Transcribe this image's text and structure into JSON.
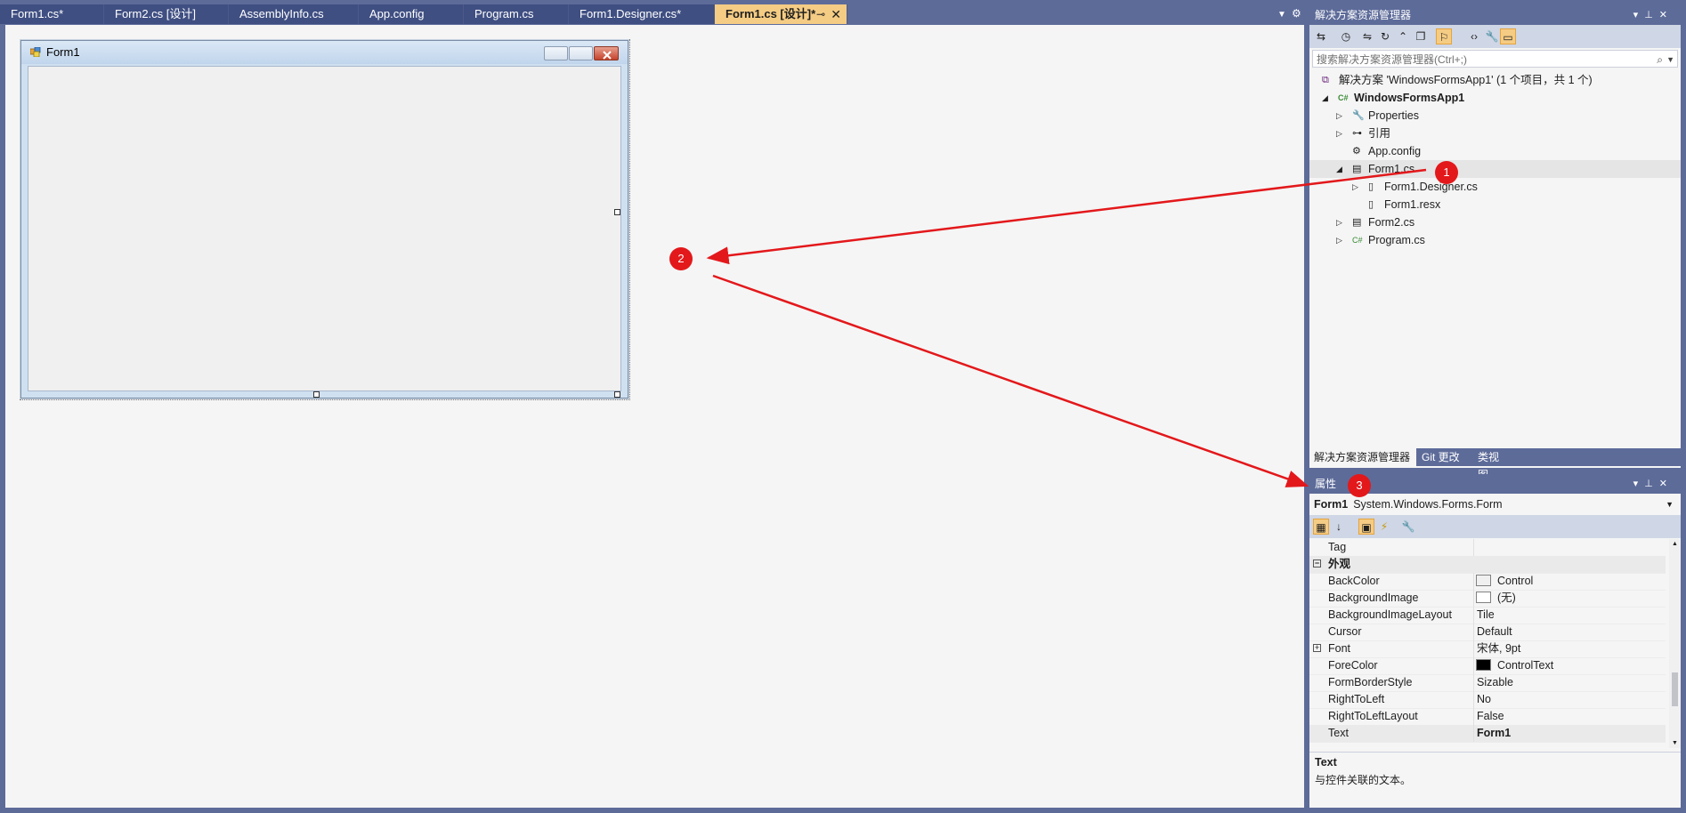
{
  "tabs": [
    {
      "label": "Form1.cs*"
    },
    {
      "label": "Form2.cs [设计]"
    },
    {
      "label": "AssemblyInfo.cs"
    },
    {
      "label": "App.config"
    },
    {
      "label": "Program.cs"
    },
    {
      "label": "Form1.Designer.cs*"
    },
    {
      "label": "Form1.cs [设计]*",
      "active": true
    }
  ],
  "designer": {
    "form_title": "Form1"
  },
  "solution_explorer": {
    "title": "解决方案资源管理器",
    "search_placeholder": "搜索解决方案资源管理器(Ctrl+;)",
    "tree": [
      {
        "label": "解决方案 'WindowsFormsApp1' (1 个项目，共 1 个)",
        "icon": "solution-icon"
      },
      {
        "label": "WindowsFormsApp1",
        "icon": "csharp-project-icon",
        "bold": true
      },
      {
        "label": "Properties",
        "icon": "wrench-icon"
      },
      {
        "label": "引用",
        "icon": "references-icon"
      },
      {
        "label": "App.config",
        "icon": "config-file-icon"
      },
      {
        "label": "Form1.cs",
        "icon": "form-icon",
        "selected": true
      },
      {
        "label": "Form1.Designer.cs",
        "icon": "cs-file-icon"
      },
      {
        "label": "Form1.resx",
        "icon": "resx-file-icon"
      },
      {
        "label": "Form2.cs",
        "icon": "form-icon"
      },
      {
        "label": "Program.cs",
        "icon": "csharp-file-icon"
      }
    ],
    "bottom_tabs": [
      "解决方案资源管理器",
      "Git 更改",
      "类视图"
    ]
  },
  "properties": {
    "title": "属性",
    "object_name": "Form1",
    "object_type": "System.Windows.Forms.Form",
    "rows": [
      {
        "name": "Tag",
        "value": ""
      },
      {
        "name": "外观",
        "category": true
      },
      {
        "name": "BackColor",
        "value": "Control",
        "swatch": "#f0f0f0"
      },
      {
        "name": "BackgroundImage",
        "value": "(无)",
        "swatch": "#ffffff"
      },
      {
        "name": "BackgroundImageLayout",
        "value": "Tile"
      },
      {
        "name": "Cursor",
        "value": "Default"
      },
      {
        "name": "Font",
        "value": "宋体, 9pt",
        "expandable": true
      },
      {
        "name": "ForeColor",
        "value": "ControlText",
        "swatch": "#000000"
      },
      {
        "name": "FormBorderStyle",
        "value": "Sizable"
      },
      {
        "name": "RightToLeft",
        "value": "No"
      },
      {
        "name": "RightToLeftLayout",
        "value": "False"
      },
      {
        "name": "Text",
        "value": "Form1",
        "bold_value": true,
        "selected": true
      }
    ],
    "description_title": "Text",
    "description_text": "与控件关联的文本。"
  },
  "annotations": [
    "1",
    "2",
    "3"
  ],
  "colors": {
    "annotation_red": "#e3181b",
    "active_tab": "#f5cc84",
    "chrome": "#5d6b99"
  }
}
